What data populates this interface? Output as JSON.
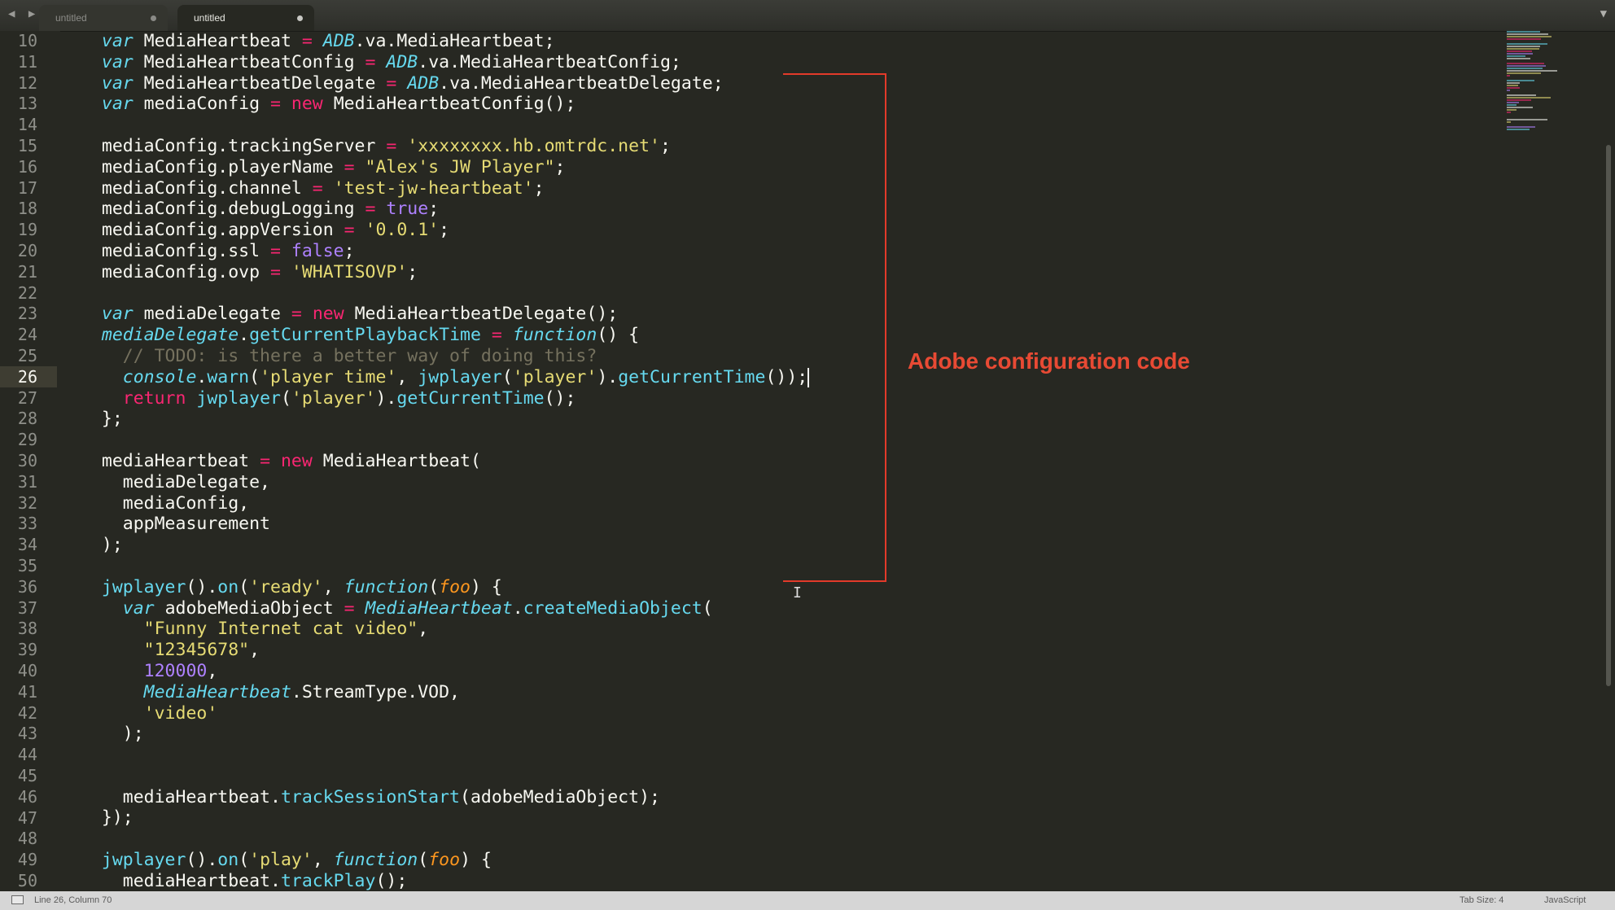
{
  "tabs": [
    {
      "label": "untitled",
      "active": false
    },
    {
      "label": "untitled",
      "active": true
    }
  ],
  "gutter": {
    "line_numbers": [
      "10",
      "11",
      "12",
      "13",
      "14",
      "15",
      "16",
      "17",
      "18",
      "19",
      "20",
      "21",
      "22",
      "23",
      "24",
      "25",
      "26",
      "27",
      "28",
      "29",
      "30",
      "31",
      "32",
      "33",
      "34",
      "35",
      "36",
      "37",
      "38",
      "39",
      "40",
      "41",
      "42",
      "43",
      "44",
      "45",
      "46",
      "47",
      "48",
      "49",
      "50"
    ],
    "current_line": "26"
  },
  "code_lines": [
    [
      {
        "t": "  "
      },
      {
        "t": "var",
        "c": "kw"
      },
      {
        "t": " MediaHeartbeat "
      },
      {
        "t": "=",
        "c": "op"
      },
      {
        "t": " "
      },
      {
        "t": "ADB",
        "c": "cls"
      },
      {
        "t": ".va.MediaHeartbeat;"
      }
    ],
    [
      {
        "t": "  "
      },
      {
        "t": "var",
        "c": "kw"
      },
      {
        "t": " MediaHeartbeatConfig "
      },
      {
        "t": "=",
        "c": "op"
      },
      {
        "t": " "
      },
      {
        "t": "ADB",
        "c": "cls"
      },
      {
        "t": ".va.MediaHeartbeatConfig;"
      }
    ],
    [
      {
        "t": "  "
      },
      {
        "t": "var",
        "c": "kw"
      },
      {
        "t": " MediaHeartbeatDelegate "
      },
      {
        "t": "=",
        "c": "op"
      },
      {
        "t": " "
      },
      {
        "t": "ADB",
        "c": "cls"
      },
      {
        "t": ".va.MediaHeartbeatDelegate;"
      }
    ],
    [
      {
        "t": "  "
      },
      {
        "t": "var",
        "c": "kw"
      },
      {
        "t": " mediaConfig "
      },
      {
        "t": "=",
        "c": "op"
      },
      {
        "t": " "
      },
      {
        "t": "new",
        "c": "rk"
      },
      {
        "t": " MediaHeartbeatConfig();"
      }
    ],
    [
      {
        "t": ""
      }
    ],
    [
      {
        "t": "  mediaConfig.trackingServer "
      },
      {
        "t": "=",
        "c": "op"
      },
      {
        "t": " "
      },
      {
        "t": "'xxxxxxxx.hb.omtrdc.net'",
        "c": "str"
      },
      {
        "t": ";"
      }
    ],
    [
      {
        "t": "  mediaConfig.playerName "
      },
      {
        "t": "=",
        "c": "op"
      },
      {
        "t": " "
      },
      {
        "t": "\"Alex's JW Player\"",
        "c": "str"
      },
      {
        "t": ";"
      }
    ],
    [
      {
        "t": "  mediaConfig.channel "
      },
      {
        "t": "=",
        "c": "op"
      },
      {
        "t": " "
      },
      {
        "t": "'test-jw-heartbeat'",
        "c": "str"
      },
      {
        "t": ";"
      }
    ],
    [
      {
        "t": "  mediaConfig.debugLogging "
      },
      {
        "t": "=",
        "c": "op"
      },
      {
        "t": " "
      },
      {
        "t": "true",
        "c": "bool"
      },
      {
        "t": ";"
      }
    ],
    [
      {
        "t": "  mediaConfig.appVersion "
      },
      {
        "t": "=",
        "c": "op"
      },
      {
        "t": " "
      },
      {
        "t": "'0.0.1'",
        "c": "str"
      },
      {
        "t": ";"
      }
    ],
    [
      {
        "t": "  mediaConfig.ssl "
      },
      {
        "t": "=",
        "c": "op"
      },
      {
        "t": " "
      },
      {
        "t": "false",
        "c": "bool"
      },
      {
        "t": ";"
      }
    ],
    [
      {
        "t": "  mediaConfig.ovp "
      },
      {
        "t": "=",
        "c": "op"
      },
      {
        "t": " "
      },
      {
        "t": "'WHATISOVP'",
        "c": "str"
      },
      {
        "t": ";"
      }
    ],
    [
      {
        "t": ""
      }
    ],
    [
      {
        "t": "  "
      },
      {
        "t": "var",
        "c": "kw"
      },
      {
        "t": " mediaDelegate "
      },
      {
        "t": "=",
        "c": "op"
      },
      {
        "t": " "
      },
      {
        "t": "new",
        "c": "rk"
      },
      {
        "t": " MediaHeartbeatDelegate();"
      }
    ],
    [
      {
        "t": "  "
      },
      {
        "t": "mediaDelegate",
        "c": "cls"
      },
      {
        "t": "."
      },
      {
        "t": "getCurrentPlaybackTime",
        "c": "fn"
      },
      {
        "t": " "
      },
      {
        "t": "=",
        "c": "op"
      },
      {
        "t": " "
      },
      {
        "t": "function",
        "c": "kw"
      },
      {
        "t": "() {"
      }
    ],
    [
      {
        "t": "    "
      },
      {
        "t": "// TODO: is there a better way of doing this?",
        "c": "cmt"
      }
    ],
    [
      {
        "t": "    "
      },
      {
        "t": "console",
        "c": "cls"
      },
      {
        "t": "."
      },
      {
        "t": "warn",
        "c": "fn"
      },
      {
        "t": "("
      },
      {
        "t": "'player time'",
        "c": "str"
      },
      {
        "t": ", "
      },
      {
        "t": "jwplayer",
        "c": "fn"
      },
      {
        "t": "("
      },
      {
        "t": "'player'",
        "c": "str"
      },
      {
        "t": ")."
      },
      {
        "t": "getCurrentTime",
        "c": "fn"
      },
      {
        "t": "());"
      },
      {
        "cursor": true
      }
    ],
    [
      {
        "t": "    "
      },
      {
        "t": "return",
        "c": "rk"
      },
      {
        "t": " "
      },
      {
        "t": "jwplayer",
        "c": "fn"
      },
      {
        "t": "("
      },
      {
        "t": "'player'",
        "c": "str"
      },
      {
        "t": ")."
      },
      {
        "t": "getCurrentTime",
        "c": "fn"
      },
      {
        "t": "();"
      }
    ],
    [
      {
        "t": "  };"
      }
    ],
    [
      {
        "t": ""
      }
    ],
    [
      {
        "t": "  mediaHeartbeat "
      },
      {
        "t": "=",
        "c": "op"
      },
      {
        "t": " "
      },
      {
        "t": "new",
        "c": "rk"
      },
      {
        "t": " MediaHeartbeat("
      }
    ],
    [
      {
        "t": "    mediaDelegate,"
      }
    ],
    [
      {
        "t": "    mediaConfig,"
      }
    ],
    [
      {
        "t": "    appMeasurement"
      }
    ],
    [
      {
        "t": "  );"
      }
    ],
    [
      {
        "t": ""
      }
    ],
    [
      {
        "t": "  "
      },
      {
        "t": "jwplayer",
        "c": "fn"
      },
      {
        "t": "()."
      },
      {
        "t": "on",
        "c": "fn"
      },
      {
        "t": "("
      },
      {
        "t": "'ready'",
        "c": "str"
      },
      {
        "t": ", "
      },
      {
        "t": "function",
        "c": "kw"
      },
      {
        "t": "("
      },
      {
        "t": "foo",
        "c": "param"
      },
      {
        "t": ") {"
      }
    ],
    [
      {
        "t": "    "
      },
      {
        "t": "var",
        "c": "kw"
      },
      {
        "t": " adobeMediaObject "
      },
      {
        "t": "=",
        "c": "op"
      },
      {
        "t": " "
      },
      {
        "t": "MediaHeartbeat",
        "c": "cls"
      },
      {
        "t": "."
      },
      {
        "t": "createMediaObject",
        "c": "fn"
      },
      {
        "t": "("
      }
    ],
    [
      {
        "t": "      "
      },
      {
        "t": "\"Funny Internet cat video\"",
        "c": "str"
      },
      {
        "t": ","
      }
    ],
    [
      {
        "t": "      "
      },
      {
        "t": "\"12345678\"",
        "c": "str"
      },
      {
        "t": ","
      }
    ],
    [
      {
        "t": "      "
      },
      {
        "t": "120000",
        "c": "num"
      },
      {
        "t": ","
      }
    ],
    [
      {
        "t": "      "
      },
      {
        "t": "MediaHeartbeat",
        "c": "cls"
      },
      {
        "t": ".StreamType.VOD,"
      }
    ],
    [
      {
        "t": "      "
      },
      {
        "t": "'video'",
        "c": "str"
      }
    ],
    [
      {
        "t": "    );"
      }
    ],
    [
      {
        "t": ""
      }
    ],
    [
      {
        "t": ""
      }
    ],
    [
      {
        "t": "    mediaHeartbeat."
      },
      {
        "t": "trackSessionStart",
        "c": "fn"
      },
      {
        "t": "(adobeMediaObject);"
      }
    ],
    [
      {
        "t": "  });"
      }
    ],
    [
      {
        "t": ""
      }
    ],
    [
      {
        "t": "  "
      },
      {
        "t": "jwplayer",
        "c": "fn"
      },
      {
        "t": "()."
      },
      {
        "t": "on",
        "c": "fn"
      },
      {
        "t": "("
      },
      {
        "t": "'play'",
        "c": "str"
      },
      {
        "t": ", "
      },
      {
        "t": "function",
        "c": "kw"
      },
      {
        "t": "("
      },
      {
        "t": "foo",
        "c": "param"
      },
      {
        "t": ") {"
      }
    ],
    [
      {
        "t": "    mediaHeartbeat."
      },
      {
        "t": "trackPlay",
        "c": "fn"
      },
      {
        "t": "();"
      }
    ]
  ],
  "annotation": {
    "label": "Adobe configuration code",
    "color": "#e84a34"
  },
  "statusbar": {
    "position": "Line 26, Column 70",
    "tab_size": "Tab Size: 4",
    "syntax": "JavaScript"
  },
  "colors": {
    "background": "#272822",
    "keyword": "#66d9ef",
    "operator": "#f92672",
    "string": "#e6db74",
    "number": "#ae81ff",
    "comment": "#75715e",
    "parameter": "#fd971f"
  }
}
